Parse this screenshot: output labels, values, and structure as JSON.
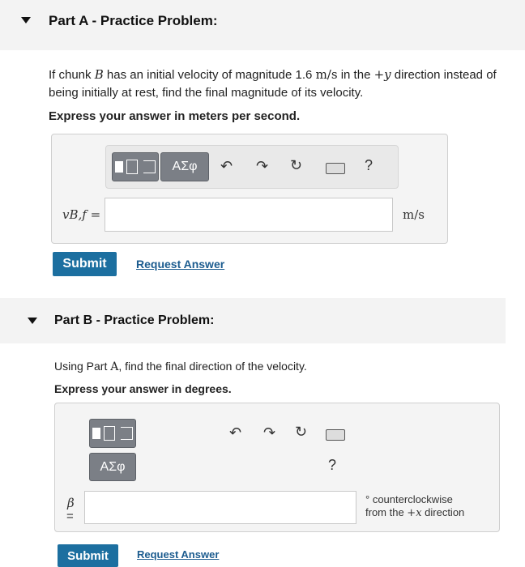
{
  "partA": {
    "title": "Part A - Practice Problem:",
    "question_prefix": "If chunk ",
    "question_var": "B",
    "question_mid": " has an initial velocity of magnitude 1.6 ",
    "question_unit": "m/s",
    "question_mid2": " in the ",
    "question_dir": "+y",
    "question_end": " direction instead of",
    "question_line2": "being initially at rest, find the final magnitude of its velocity.",
    "instruction": "Express your answer in meters per second.",
    "toolbar": {
      "sym_btn": "ΑΣφ",
      "help": "?"
    },
    "answer_label": "vB,f =",
    "answer_value": "",
    "unit": "m/s",
    "submit": "Submit",
    "request": "Request Answer"
  },
  "partB": {
    "title": "Part B - Practice Problem:",
    "question_prefix": "Using Part ",
    "question_var": "A",
    "question_end": ", find the final direction of the velocity.",
    "instruction": "Express your answer in degrees.",
    "toolbar": {
      "sym_btn": "ΑΣφ",
      "help": "?"
    },
    "answer_label_var": "β",
    "answer_label_eq": "=",
    "answer_value": "",
    "unit_deg": "°",
    "unit_line1": "counterclockwise",
    "unit_line2_prefix": "from the ",
    "unit_line2_var": "+x",
    "unit_line2_suffix": " direction",
    "submit": "Submit",
    "request": "Request Answer"
  }
}
